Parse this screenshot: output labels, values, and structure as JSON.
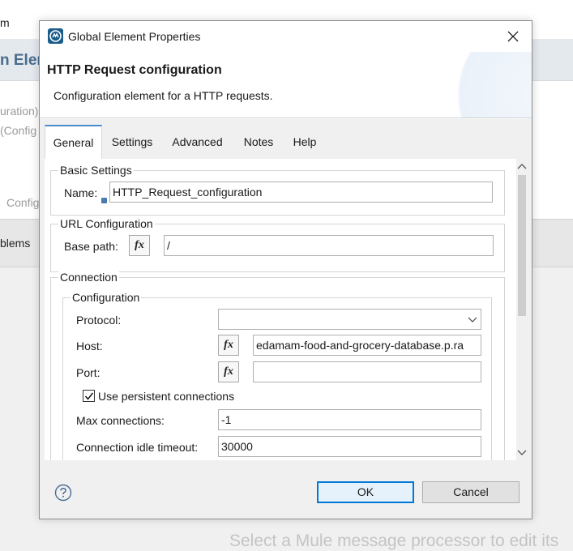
{
  "background": {
    "menu_fragment": "m",
    "title_fragment": "n Elem",
    "line1": "uration)",
    "line2": "(Config",
    "line3": "Config",
    "problems_label": "blems",
    "footer_text": "Select a Mule message processor to edit its"
  },
  "dialog": {
    "window_title": "Global Element Properties",
    "icon": "mule-app-icon",
    "header_title": "HTTP Request configuration",
    "header_description": "Configuration element for a HTTP requests.",
    "tabs": [
      {
        "label": "General",
        "active": true
      },
      {
        "label": "Settings",
        "active": false
      },
      {
        "label": "Advanced",
        "active": false
      },
      {
        "label": "Notes",
        "active": false
      },
      {
        "label": "Help",
        "active": false
      }
    ],
    "basic_settings": {
      "legend": "Basic Settings",
      "name_label": "Name:",
      "name_value": "HTTP_Request_configuration"
    },
    "url_configuration": {
      "legend": "URL Configuration",
      "base_path_label": "Base path:",
      "base_path_value": "/"
    },
    "connection": {
      "legend": "Connection",
      "configuration": {
        "legend": "Configuration",
        "protocol_label": "Protocol:",
        "protocol_value": "",
        "host_label": "Host:",
        "host_value": "edamam-food-and-grocery-database.p.ra",
        "port_label": "Port:",
        "port_value": "",
        "persistent_label": "Use persistent connections",
        "persistent_checked": true,
        "max_connections_label": "Max connections:",
        "max_connections_value": "-1",
        "idle_timeout_label": "Connection idle timeout:",
        "idle_timeout_value": "30000"
      }
    },
    "fx_glyph": "fx",
    "ok_label": "OK",
    "cancel_label": "Cancel"
  },
  "colors": {
    "accent": "#0078d7",
    "tab_active_border": "#4a8ccf",
    "app_icon": "#1a5c8a"
  }
}
